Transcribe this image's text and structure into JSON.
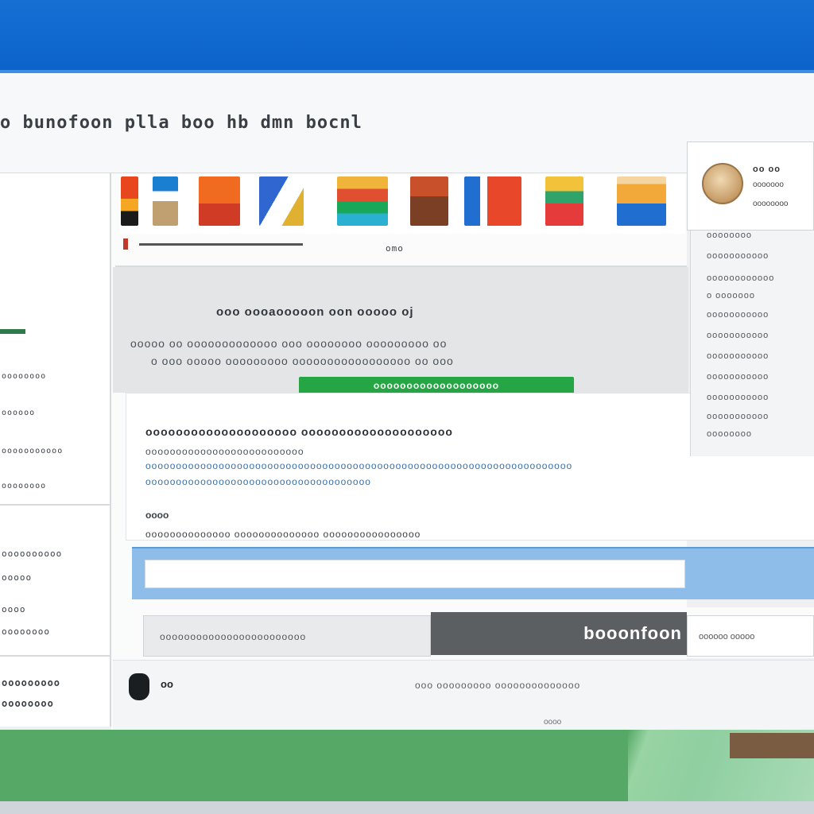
{
  "window": {
    "title": "",
    "page_heading": "o bunofoon plla boo hb dmn bocnl"
  },
  "thumbnails": [
    {
      "name": "thumb-1",
      "colors": [
        "#e8461e",
        "#1a7fd1"
      ]
    },
    {
      "name": "thumb-2",
      "colors": [
        "#f2c23a",
        "#3a86cc"
      ]
    },
    {
      "name": "thumb-3",
      "colors": [
        "#f06a20",
        "#cf3b25"
      ]
    },
    {
      "name": "thumb-4",
      "colors": [
        "#2f66d0",
        "#8ec0ff"
      ]
    },
    {
      "name": "thumb-5",
      "colors": [
        "#19a75a",
        "#f0b43a"
      ]
    },
    {
      "name": "thumb-6",
      "colors": [
        "#c8502a",
        "#7a3f25"
      ]
    },
    {
      "name": "thumb-7",
      "colors": [
        "#e9472a",
        "#3382d8"
      ]
    },
    {
      "name": "thumb-8",
      "colors": [
        "#2ea36a",
        "#e63b3b"
      ]
    },
    {
      "name": "thumb-9",
      "colors": [
        "#1f6ed0",
        "#f2a93a"
      ]
    }
  ],
  "subbar": {
    "caption": "omo"
  },
  "promo": {
    "heading": "ooo oooaooooon oon ooooo oj",
    "desc1": "ooooo oo ooooooooooooo ooo oooooooo ooooooooo oo",
    "desc2": "o ooo ooooo ooooooooo ooooooooooooooooo oo ooo",
    "cta_label": "ooooooooooooooooooo"
  },
  "article": {
    "title": "oooooooooooooooooooo oooooooooooooooooooo",
    "line2": "oooooooooooooooooooooooooo",
    "line3": "oooooooooooooooooooooooooooooooooooooooooooooooooooooooooooooooooooooo",
    "line4": "ooooooooooooooooooooooooooooooooooooo",
    "label": "oooo",
    "line6": "oooooooooooooo oooooooooooooo oooooooooooooooo"
  },
  "input": {
    "value": "",
    "placeholder": ""
  },
  "actions": {
    "left_field": "oooooooooooooooooooooooo",
    "primary_button": "booonfoon",
    "right_field": "oooooo ooooo"
  },
  "footer": {
    "label": "oo",
    "link": "ooo ooooooooo oooooooooooooo",
    "small": "oooo"
  },
  "profile": {
    "name": "oo oo",
    "line2": "ooooooo",
    "line3": "oooooooo"
  },
  "sidepanel": {
    "lines": [
      "oooooooo",
      "ooooooooooo",
      "oooooooooooo",
      "o  ooooooo",
      "ooooooooooo",
      "ooooooooooo",
      "ooooooooooo",
      "ooooooooooo",
      "ooooooooooo",
      "ooooooooooo",
      "oooooooo"
    ]
  },
  "sidebar": {
    "sections": [
      {
        "lines": [
          "oooooooo",
          "oooooo",
          "ooooooooooo",
          "oooooooo"
        ]
      },
      {
        "lines": [
          "oooooooooo",
          "ooooo",
          "oooo",
          "oooooooo"
        ]
      },
      {
        "lines": [
          "ooooooooo",
          "oooooooo"
        ]
      }
    ]
  }
}
